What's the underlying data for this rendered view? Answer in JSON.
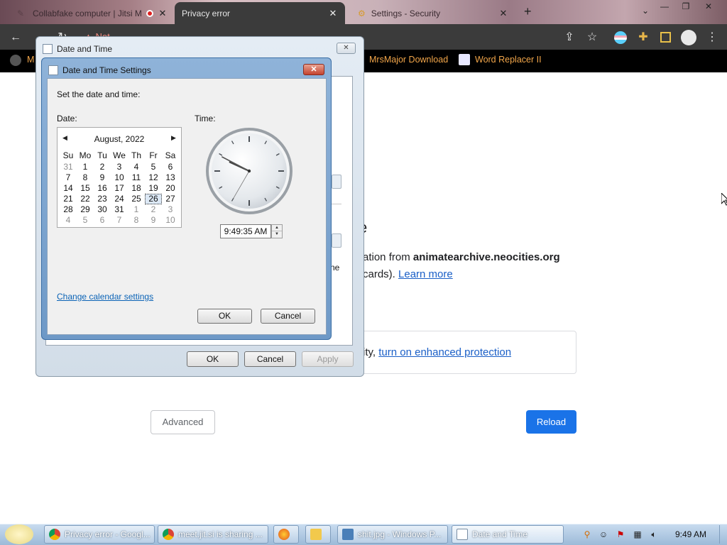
{
  "browser": {
    "tabs": [
      {
        "label": "Collabfake computer | Jitsi M",
        "recording": true
      },
      {
        "label": "Privacy error"
      },
      {
        "label": "Settings - Security"
      }
    ],
    "url_fragment": "Not",
    "bookmarks": [
      {
        "label": "M"
      },
      {
        "label": "MrsMajor Download"
      },
      {
        "label": "Word Replacer II"
      }
    ]
  },
  "page": {
    "heading_fragment": "e",
    "line1_prefix": "ation from ",
    "line1_domain": "animatearchive.neocities.org",
    "line2_prefix": "cards). ",
    "learn_more": "Learn more",
    "enhanced_prefix": "ity, ",
    "enhanced_link": "turn on enhanced protection",
    "advanced_button": "Advanced",
    "reload_button": "Reload"
  },
  "outer_dialog": {
    "title": "Date and Time",
    "partial_text": "ne",
    "ok": "OK",
    "cancel": "Cancel",
    "apply": "Apply"
  },
  "dialog": {
    "title": "Date and Time Settings",
    "instruction": "Set the date and time:",
    "date_label": "Date:",
    "time_label": "Time:",
    "calendar": {
      "month": "August, 2022",
      "weekdays": [
        "Su",
        "Mo",
        "Tu",
        "We",
        "Th",
        "Fr",
        "Sa"
      ],
      "weeks": [
        [
          "31",
          "1",
          "2",
          "3",
          "4",
          "5",
          "6"
        ],
        [
          "7",
          "8",
          "9",
          "10",
          "11",
          "12",
          "13"
        ],
        [
          "14",
          "15",
          "16",
          "17",
          "18",
          "19",
          "20"
        ],
        [
          "21",
          "22",
          "23",
          "24",
          "25",
          "26",
          "27"
        ],
        [
          "28",
          "29",
          "30",
          "31",
          "1",
          "2",
          "3"
        ],
        [
          "4",
          "5",
          "6",
          "7",
          "8",
          "9",
          "10"
        ]
      ],
      "selected_day": "26"
    },
    "time_value": "9:49:35 AM",
    "clock": {
      "hour": 9,
      "minute": 49,
      "second": 35
    },
    "change_calendar_link": "Change calendar settings",
    "ok": "OK",
    "cancel": "Cancel"
  },
  "taskbar": {
    "items": [
      {
        "label": "Privacy error - Googl..."
      },
      {
        "label": "meet.jit.si is sharing ..."
      },
      {
        "label": "shit.jpg - Windows P..."
      },
      {
        "label": "Date and Time"
      }
    ],
    "clock": "9:49 AM"
  },
  "colors": {
    "link": "#1a5fc7",
    "reload_button": "#1a73e8",
    "bookmark_text": "#f2a64a"
  }
}
